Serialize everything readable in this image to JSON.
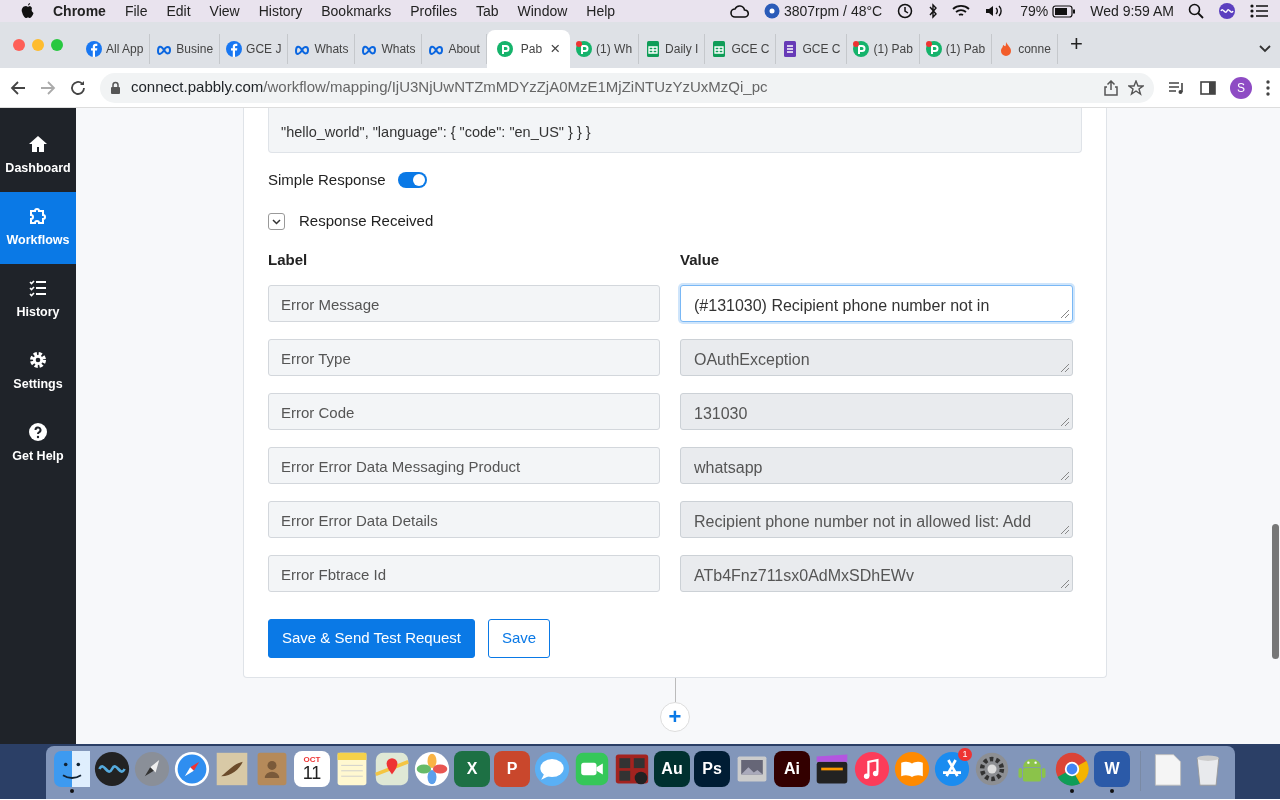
{
  "menu_bar": {
    "app": "Chrome",
    "items": [
      "File",
      "Edit",
      "View",
      "History",
      "Bookmarks",
      "Profiles",
      "Tab",
      "Window",
      "Help"
    ],
    "fan": "3807rpm / 48°C",
    "battery": "79%",
    "clock": "Wed 9:59 AM"
  },
  "tabs": [
    {
      "title": "All App",
      "kind": "facebook",
      "selected": false
    },
    {
      "title": "Busine",
      "kind": "meta",
      "selected": false
    },
    {
      "title": "GCE J",
      "kind": "facebook",
      "selected": false
    },
    {
      "title": "Whats",
      "kind": "meta",
      "selected": false
    },
    {
      "title": "Whats",
      "kind": "meta",
      "selected": false
    },
    {
      "title": "About",
      "kind": "meta",
      "selected": false
    },
    {
      "title": "Pab",
      "kind": "pabbly",
      "selected": true,
      "close": "×"
    },
    {
      "title": "(1) Wh",
      "kind": "pabbly-alert",
      "selected": false
    },
    {
      "title": "Daily I",
      "kind": "sheets",
      "selected": false
    },
    {
      "title": "GCE C",
      "kind": "sheets",
      "selected": false
    },
    {
      "title": "GCE C",
      "kind": "forms",
      "selected": false
    },
    {
      "title": "(1) Pab",
      "kind": "pabbly-alert",
      "selected": false
    },
    {
      "title": "(1) Pab",
      "kind": "pabbly-alert",
      "selected": false
    },
    {
      "title": "conne",
      "kind": "fire",
      "selected": false
    }
  ],
  "new_tab": "+",
  "address_bar": {
    "host": "connect.pabbly.com",
    "path": "/workflow/mapping/IjU3NjUwNTZmMDYzZjA0MzE1MjZiNTUzYzUxMzQi_pc"
  },
  "profile": "S",
  "sidebar": {
    "items": [
      {
        "label": "Dashboard",
        "kind": "home",
        "selected": false
      },
      {
        "label": "Workflows",
        "kind": "puzzle",
        "selected": true
      },
      {
        "label": "History",
        "kind": "list",
        "selected": false
      },
      {
        "label": "Settings",
        "kind": "gear",
        "selected": false
      },
      {
        "label": "Get Help",
        "kind": "help",
        "selected": false
      }
    ]
  },
  "request_body": "\"hello_world\", \"language\": { \"code\": \"en_US\" } } }",
  "simple_response": {
    "label": "Simple Response",
    "on": true
  },
  "response_received": {
    "label": "Response Received",
    "expanded": true
  },
  "columns": [
    "Label",
    "Value"
  ],
  "rows": [
    {
      "label": "Error Message",
      "value": "(#131030) Recipient phone number not in",
      "focused": true
    },
    {
      "label": "Error Type",
      "value": "OAuthException",
      "focused": false
    },
    {
      "label": "Error Code",
      "value": "131030",
      "focused": false
    },
    {
      "label": "Error Error Data Messaging Product",
      "value": "whatsapp",
      "focused": false
    },
    {
      "label": "Error Error Data Details",
      "value": "Recipient phone number not in allowed list: Add",
      "focused": false
    },
    {
      "label": "Error Fbtrace Id",
      "value": "ATb4Fnz711sx0AdMxSDhEWv",
      "focused": false
    }
  ],
  "buttons": [
    {
      "label": "Save & Send Test Request",
      "kind": "primary"
    },
    {
      "label": "Save",
      "kind": "outline"
    }
  ],
  "add_step": "+",
  "dock": [
    {
      "kind": "finder",
      "running": true
    },
    {
      "kind": "siri",
      "running": false
    },
    {
      "kind": "rocket",
      "running": false
    },
    {
      "kind": "safari",
      "running": false
    },
    {
      "kind": "mail",
      "running": false
    },
    {
      "kind": "contacts",
      "running": false
    },
    {
      "kind": "calendar",
      "month": "OCT",
      "day": "11",
      "running": false
    },
    {
      "kind": "notes",
      "running": false
    },
    {
      "kind": "maps",
      "running": false
    },
    {
      "kind": "photos",
      "running": false
    },
    {
      "kind": "tile",
      "label": "X",
      "color": "#1d7044",
      "running": false
    },
    {
      "kind": "tile",
      "label": "P",
      "color": "#c9472c",
      "running": false
    },
    {
      "kind": "messages",
      "running": false
    },
    {
      "kind": "facetime",
      "running": false
    },
    {
      "kind": "photobooth",
      "running": false
    },
    {
      "kind": "tile",
      "label": "Au",
      "color": "#00312f",
      "running": false
    },
    {
      "kind": "tile",
      "label": "Ps",
      "color": "#001d34",
      "running": false
    },
    {
      "kind": "preview",
      "running": false
    },
    {
      "kind": "tile",
      "label": "Ai",
      "color": "#330000",
      "running": false
    },
    {
      "kind": "clapper",
      "running": false
    },
    {
      "kind": "music",
      "running": false
    },
    {
      "kind": "books",
      "running": false
    },
    {
      "kind": "appstore",
      "badge": "1",
      "running": false
    },
    {
      "kind": "gear",
      "running": false
    },
    {
      "kind": "android",
      "running": false
    },
    {
      "kind": "chrome",
      "running": true
    },
    {
      "kind": "tile",
      "label": "W",
      "color": "#2b5aa8",
      "running": true
    },
    {
      "kind": "divider"
    },
    {
      "kind": "document",
      "running": false
    },
    {
      "kind": "trash",
      "running": false
    }
  ]
}
